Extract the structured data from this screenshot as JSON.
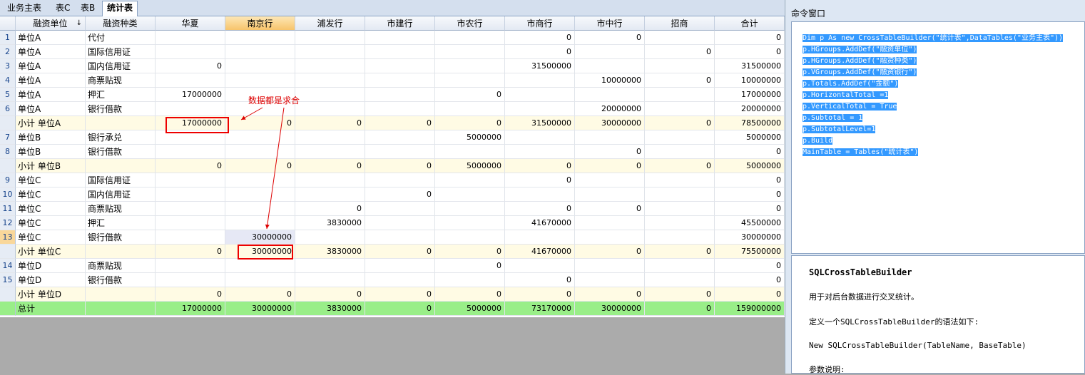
{
  "tabs": [
    "业务主表",
    "表C",
    "表B",
    "统计表"
  ],
  "grid": {
    "headers": [
      "融资单位",
      "融资种类",
      "华夏",
      "南京行",
      "浦发行",
      "市建行",
      "市农行",
      "市商行",
      "市中行",
      "招商",
      "合计"
    ],
    "sort_glyph": "↓",
    "rows": [
      {
        "rn": "1",
        "kind": "data",
        "c": [
          "单位A",
          "代付",
          "",
          "",
          "",
          "",
          "",
          "0",
          "0",
          "",
          "0"
        ]
      },
      {
        "rn": "2",
        "kind": "data",
        "c": [
          "单位A",
          "国际信用证",
          "",
          "",
          "",
          "",
          "",
          "0",
          "",
          "0",
          "0"
        ]
      },
      {
        "rn": "3",
        "kind": "data",
        "c": [
          "单位A",
          "国内信用证",
          "0",
          "",
          "",
          "",
          "",
          "31500000",
          "",
          "",
          "31500000"
        ]
      },
      {
        "rn": "4",
        "kind": "data",
        "c": [
          "单位A",
          "商票贴现",
          "",
          "",
          "",
          "",
          "",
          "",
          "10000000",
          "0",
          "10000000"
        ]
      },
      {
        "rn": "5",
        "kind": "data",
        "c": [
          "单位A",
          "押汇",
          "17000000",
          "",
          "",
          "",
          "0",
          "",
          "",
          "",
          "17000000"
        ]
      },
      {
        "rn": "6",
        "kind": "data",
        "c": [
          "单位A",
          "银行借款",
          "",
          "",
          "",
          "",
          "",
          "",
          "20000000",
          "",
          "20000000"
        ]
      },
      {
        "rn": "",
        "kind": "subtotal",
        "c": [
          "小计  单位A",
          "",
          "17000000",
          "0",
          "0",
          "0",
          "0",
          "31500000",
          "30000000",
          "0",
          "78500000"
        ]
      },
      {
        "rn": "7",
        "kind": "data",
        "c": [
          "单位B",
          "银行承兑",
          "",
          "",
          "",
          "",
          "5000000",
          "",
          "",
          "",
          "5000000"
        ]
      },
      {
        "rn": "8",
        "kind": "data",
        "c": [
          "单位B",
          "银行借款",
          "",
          "",
          "",
          "",
          "",
          "",
          "0",
          "",
          "0"
        ]
      },
      {
        "rn": "",
        "kind": "subtotal",
        "c": [
          "小计  单位B",
          "",
          "0",
          "0",
          "0",
          "0",
          "5000000",
          "0",
          "0",
          "0",
          "5000000"
        ]
      },
      {
        "rn": "9",
        "kind": "data",
        "c": [
          "单位C",
          "国际信用证",
          "",
          "",
          "",
          "",
          "",
          "0",
          "",
          "",
          "0"
        ]
      },
      {
        "rn": "10",
        "kind": "data",
        "c": [
          "单位C",
          "国内信用证",
          "",
          "",
          "",
          "0",
          "",
          "",
          "",
          "",
          "0"
        ]
      },
      {
        "rn": "11",
        "kind": "data",
        "c": [
          "单位C",
          "商票贴现",
          "",
          "",
          "0",
          "",
          "",
          "0",
          "0",
          "",
          "0"
        ]
      },
      {
        "rn": "12",
        "kind": "data",
        "c": [
          "单位C",
          "押汇",
          "",
          "",
          "3830000",
          "",
          "",
          "41670000",
          "",
          "",
          "45500000"
        ]
      },
      {
        "rn": "13",
        "kind": "data",
        "c": [
          "单位C",
          "银行借款",
          "",
          "30000000",
          "",
          "",
          "",
          "",
          "",
          "",
          "30000000"
        ]
      },
      {
        "rn": "",
        "kind": "subtotal",
        "c": [
          "小计  单位C",
          "",
          "0",
          "30000000",
          "3830000",
          "0",
          "0",
          "41670000",
          "0",
          "0",
          "75500000"
        ]
      },
      {
        "rn": "14",
        "kind": "data",
        "c": [
          "单位D",
          "商票贴现",
          "",
          "",
          "",
          "",
          "0",
          "",
          "",
          "",
          "0"
        ]
      },
      {
        "rn": "15",
        "kind": "data",
        "c": [
          "单位D",
          "银行借款",
          "",
          "",
          "",
          "",
          "",
          "0",
          "",
          "",
          "0"
        ]
      },
      {
        "rn": "",
        "kind": "subtotal",
        "c": [
          "小计  单位D",
          "",
          "0",
          "0",
          "0",
          "0",
          "0",
          "0",
          "0",
          "0",
          "0"
        ]
      },
      {
        "rn": "",
        "kind": "total",
        "c": [
          "总计",
          "",
          "17000000",
          "30000000",
          "3830000",
          "0",
          "5000000",
          "73170000",
          "30000000",
          "0",
          "159000000"
        ]
      }
    ]
  },
  "annotation": "数据都是求合",
  "command_window": {
    "title": "命令窗口",
    "code_lines": [
      "Dim p As new CrossTableBuilder(\"统计表\",DataTables(\"业务主表\"))",
      "p.HGroups.AddDef(\"融资单位\")",
      "p.HGroups.AddDef(\"融资种类\")",
      "p.VGroups.AddDef(\"融资银行\")",
      "p.Totals.AddDef(\"金额\")",
      "p.HorizontalTotal =1",
      "p.VerticalTotal = True",
      "p.Subtotal = 1",
      "p.SubtotalLevel=1",
      "p.Build",
      "MainTable = Tables(\"统计表\")"
    ],
    "help": [
      "SQLCrossTableBuilder",
      "用于对后台数据进行交叉统计。",
      "定义一个SQLCrossTableBuilder的语法如下:",
      "New SQLCrossTableBuilder(TableName, BaseTable)",
      "参数说明:"
    ]
  }
}
